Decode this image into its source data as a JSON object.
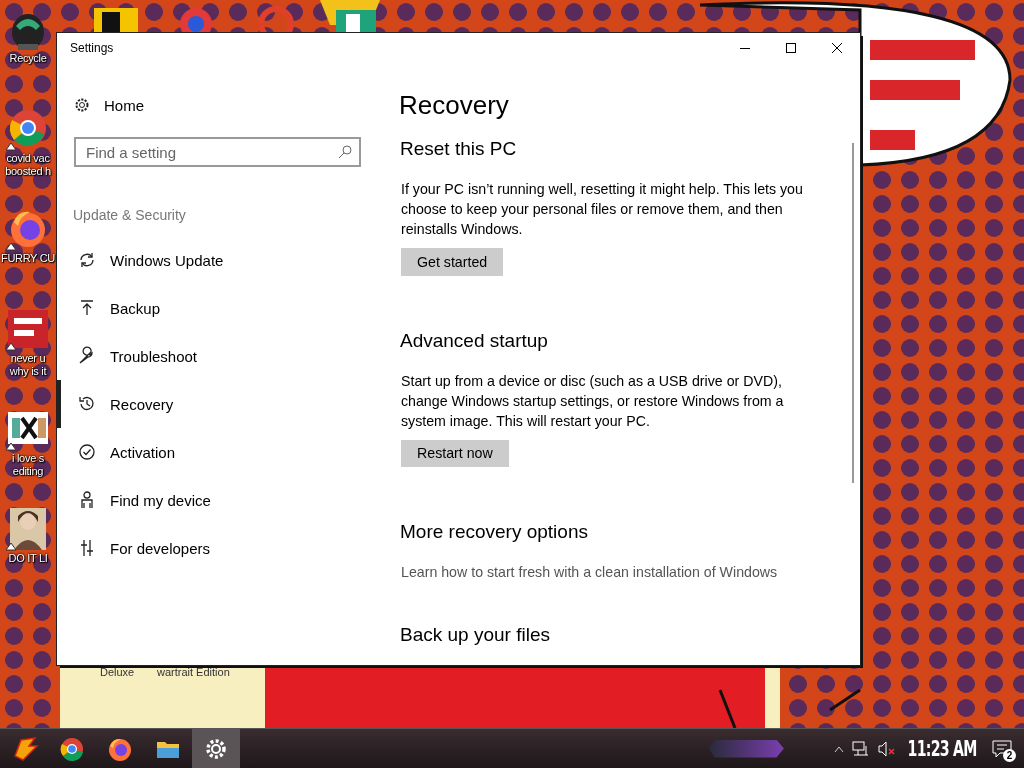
{
  "desktop": {
    "icons": [
      {
        "lines": [
          "Recycle"
        ]
      },
      {
        "lines": [
          "covid vac",
          "boosted h"
        ]
      },
      {
        "lines": [
          "FURRY CU"
        ]
      },
      {
        "lines": [
          "never u",
          "why is it"
        ]
      },
      {
        "lines": [
          "i love s",
          "editing"
        ]
      },
      {
        "lines": [
          "DO IT LI"
        ]
      }
    ],
    "bottom_labels": [
      "Deluxe",
      "wartrait Edition"
    ]
  },
  "window": {
    "title": "Settings",
    "sidebar": {
      "home": "Home",
      "search": {
        "placeholder": "Find a setting"
      },
      "section": "Update & Security",
      "items": [
        {
          "label": "Windows Update",
          "selected": false
        },
        {
          "label": "Backup",
          "selected": false
        },
        {
          "label": "Troubleshoot",
          "selected": false
        },
        {
          "label": "Recovery",
          "selected": true
        },
        {
          "label": "Activation",
          "selected": false
        },
        {
          "label": "Find my device",
          "selected": false
        },
        {
          "label": "For developers",
          "selected": false
        }
      ]
    },
    "content": {
      "title": "Recovery",
      "sections": [
        {
          "heading": "Reset this PC",
          "text": "If your PC isn’t running well, resetting it might help. This lets you choose to keep your personal files or remove them, and then reinstalls Windows.",
          "button": "Get started"
        },
        {
          "heading": "Advanced startup",
          "text": "Start up from a device or disc (such as a USB drive or DVD), change Windows startup settings, or restore Windows from a system image. This will restart your PC.",
          "button": "Restart now"
        },
        {
          "heading": "More recovery options",
          "link": "Learn how to start fresh with a clean installation of Windows"
        },
        {
          "heading": "Back up your files"
        }
      ]
    }
  },
  "taskbar": {
    "apps": [
      {
        "selected": false
      },
      {
        "selected": false
      },
      {
        "selected": false
      },
      {
        "selected": false
      },
      {
        "selected": true
      }
    ],
    "tray": {
      "volume_muted": true,
      "time": "11:23 AM",
      "notifications": "2"
    }
  }
}
